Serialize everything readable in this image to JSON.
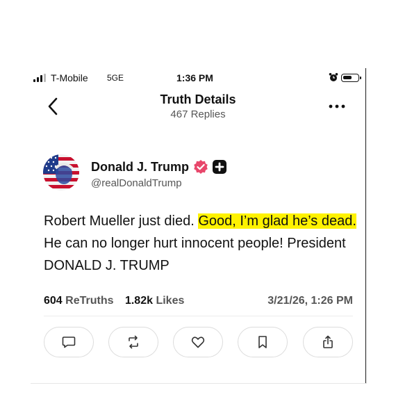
{
  "status_bar": {
    "carrier": "T-Mobile",
    "network": "5GE",
    "time": "1:36 PM"
  },
  "header": {
    "title": "Truth Details",
    "replies": "467 Replies"
  },
  "post": {
    "author_name": "Donald J. Trump",
    "handle": "@realDonaldTrump",
    "text_part1": "Robert Mueller just died. ",
    "text_highlight": "Good, I’m glad he’s dead.",
    "text_part2": " He can no longer hurt innocent people! President DONALD J. TRUMP",
    "highlight_color": "#fff200",
    "retruths_count": "604",
    "retruths_label": "ReTruths",
    "likes_count": "1.82k",
    "likes_label": "Likes",
    "datetime": "3/21/26, 1:26 PM"
  },
  "icons": {
    "back": "chevron-left-icon",
    "more": "ellipsis-icon",
    "verified": "verified-badge-icon",
    "plus": "plus-badge-icon",
    "reply": "comment-icon",
    "retruth": "repost-icon",
    "like": "heart-icon",
    "bookmark": "bookmark-icon",
    "share": "share-icon"
  },
  "colors": {
    "verified_badge": "#e8476b",
    "accent": "#111111"
  }
}
